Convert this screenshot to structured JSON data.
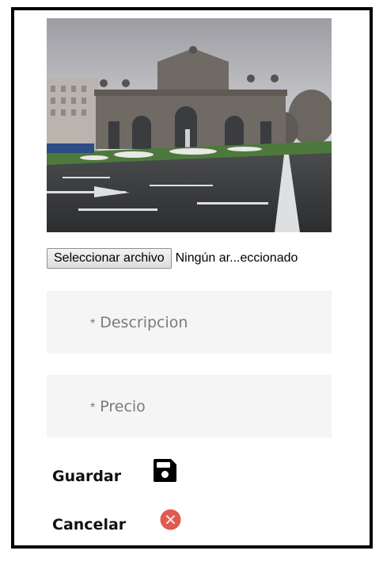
{
  "upload": {
    "button_label": "Seleccionar archivo",
    "file_status": "Ningún ar...eccionado"
  },
  "form": {
    "description": {
      "required_marker": "*",
      "placeholder": "Descripcion",
      "value": ""
    },
    "price": {
      "required_marker": "*",
      "placeholder": "Precio",
      "value": ""
    }
  },
  "actions": {
    "save_label": "Guardar",
    "save_icon": "floppy-disk-icon",
    "cancel_label": "Cancelar",
    "cancel_icon": "close-circle-icon"
  },
  "colors": {
    "border": "#000000",
    "field_bg": "#f5f5f5",
    "cancel_red": "#e05a4f"
  }
}
